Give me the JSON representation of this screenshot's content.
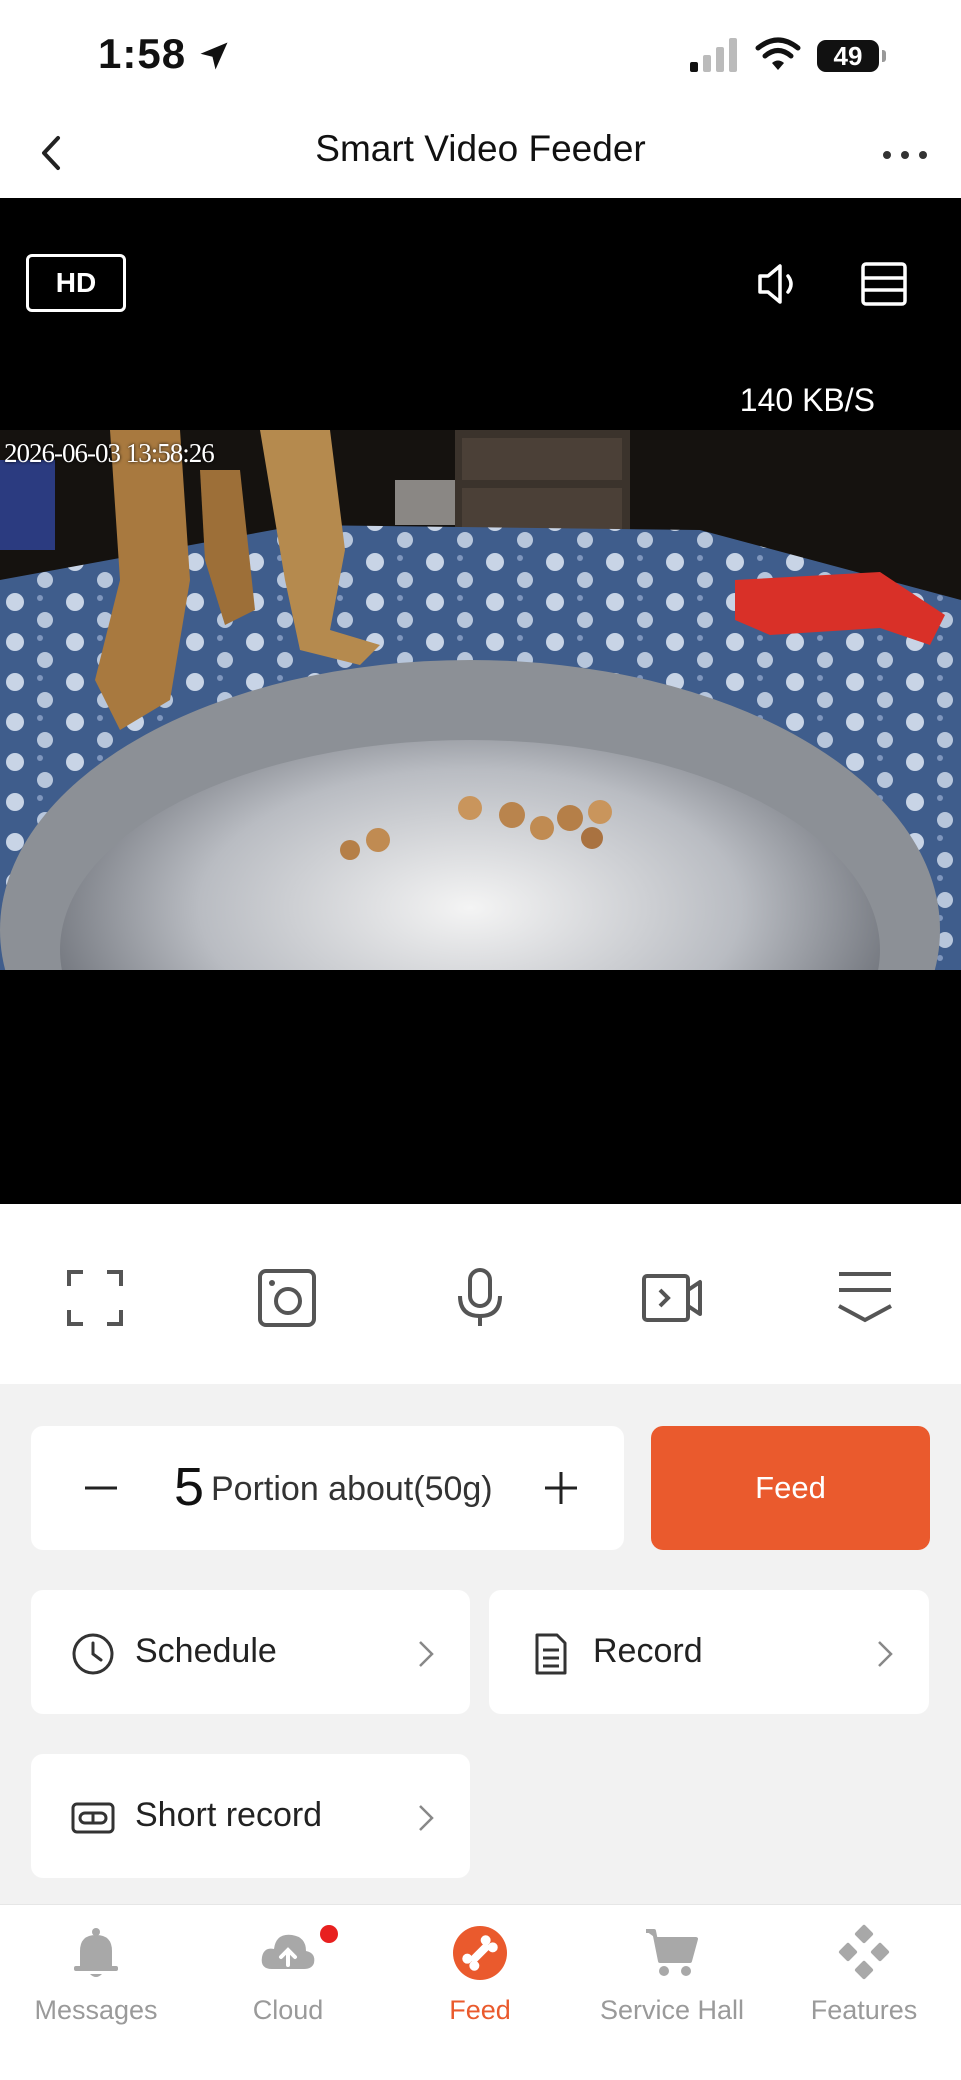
{
  "status_bar": {
    "time": "1:58",
    "battery": "49"
  },
  "nav": {
    "title": "Smart Video Feeder"
  },
  "video": {
    "quality_label": "HD",
    "bitrate": "140 KB/S",
    "timestamp": "2026-06-03 13:58:26"
  },
  "controls": [
    "fullscreen-icon",
    "snapshot-icon",
    "microphone-icon",
    "record-video-icon",
    "collapse-icon"
  ],
  "feed": {
    "portion_count": "5",
    "portion_label": "Portion about(50g)",
    "feed_label": "Feed"
  },
  "menu": {
    "schedule": "Schedule",
    "record": "Record",
    "short_record": "Short record"
  },
  "tabs": [
    {
      "label": "Messages",
      "icon": "bell-icon"
    },
    {
      "label": "Cloud",
      "icon": "cloud-icon"
    },
    {
      "label": "Feed",
      "icon": "bone-icon"
    },
    {
      "label": "Service Hall",
      "icon": "cart-icon"
    },
    {
      "label": "Features",
      "icon": "features-icon"
    }
  ],
  "colors": {
    "accent": "#ea5a2d",
    "badge": "#e8201f",
    "inactive": "#9a9a9a"
  }
}
